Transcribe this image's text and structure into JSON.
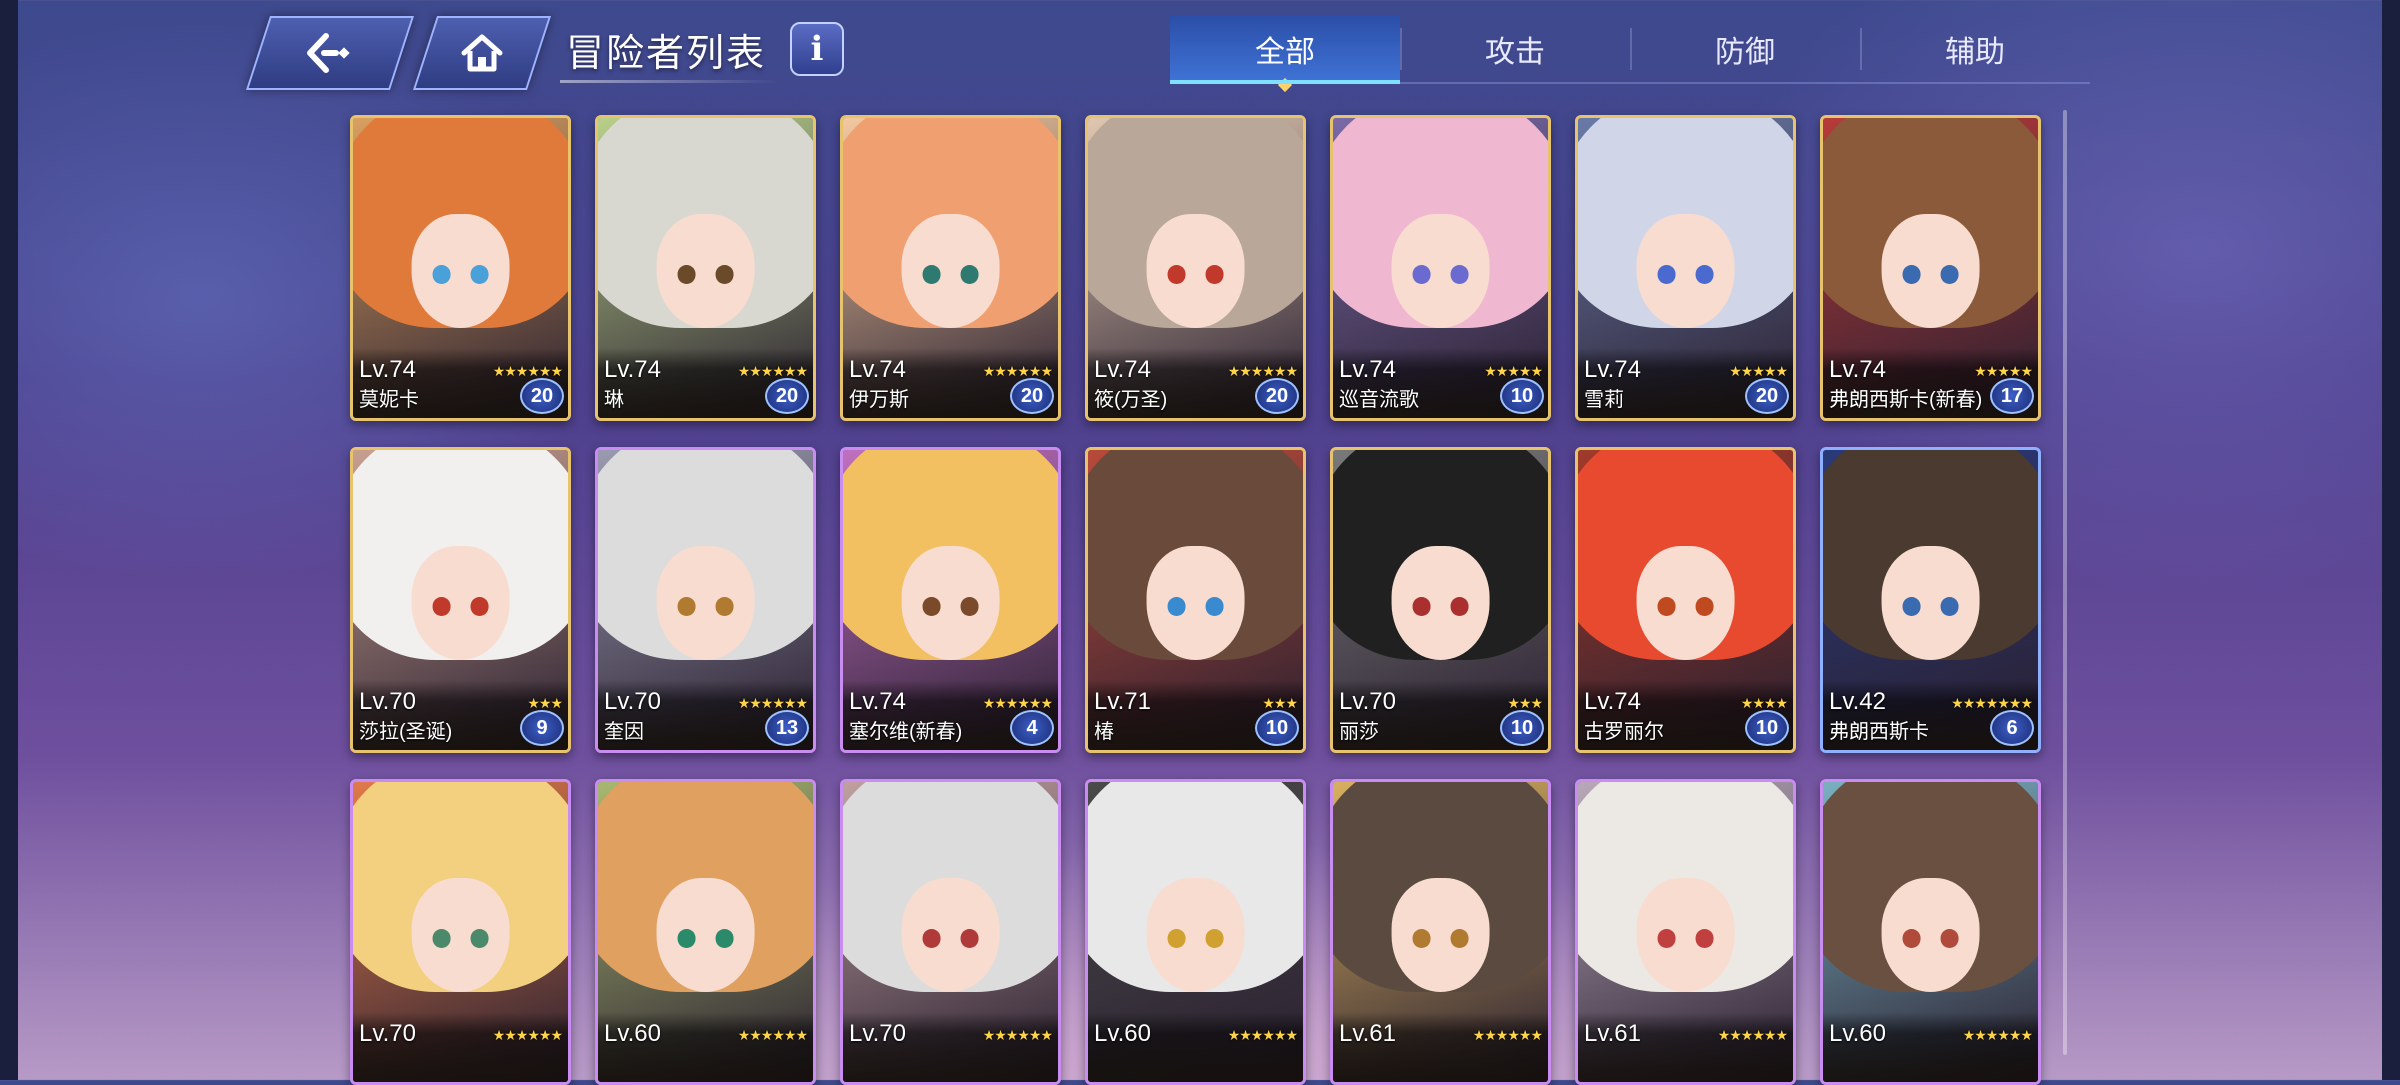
{
  "header": {
    "title": "冒险者列表",
    "info_label": "i",
    "tabs": [
      {
        "label": "全部",
        "active": true
      },
      {
        "label": "攻击",
        "active": false
      },
      {
        "label": "防御",
        "active": false
      },
      {
        "label": "辅助",
        "active": false
      }
    ]
  },
  "cards": [
    {
      "level": "Lv.74",
      "stars": "★★★★★★",
      "name": "莫妮卡",
      "badge": "20",
      "frame": "gold",
      "hair": "#e07a3a",
      "bg": "#d9a060",
      "eye": "#4aa0d8"
    },
    {
      "level": "Lv.74",
      "stars": "★★★★★★",
      "name": "琳",
      "badge": "20",
      "frame": "gold",
      "hair": "#d8d8d0",
      "bg": "#b8d08a",
      "eye": "#6b4a2a"
    },
    {
      "level": "Lv.74",
      "stars": "★★★★★★",
      "name": "伊万斯",
      "badge": "20",
      "frame": "gold",
      "hair": "#f0a070",
      "bg": "#f3c9a0",
      "eye": "#2f7a70"
    },
    {
      "level": "Lv.74",
      "stars": "★★★★★★",
      "name": "筱(万圣)",
      "badge": "20",
      "frame": "gold",
      "hair": "#b9a79a",
      "bg": "#e0c7b0",
      "eye": "#c0392b"
    },
    {
      "level": "Lv.74",
      "stars": "★★★★★",
      "name": "巡音流歌",
      "badge": "10",
      "frame": "gold",
      "hair": "#f0b8d0",
      "bg": "#7a6aa8",
      "eye": "#6a6ad0"
    },
    {
      "level": "Lv.74",
      "stars": "★★★★★",
      "name": "雪莉",
      "badge": "20",
      "frame": "gold",
      "hair": "#d0d6e8",
      "bg": "#6a7aa8",
      "eye": "#4a6ad0"
    },
    {
      "level": "Lv.74",
      "stars": "★★★★★",
      "name": "弗朗西斯卡(新春)",
      "badge": "17",
      "frame": "gold",
      "hair": "#8a5a3a",
      "bg": "#b83a3a",
      "eye": "#3a6ab0"
    },
    {
      "level": "Lv.70",
      "stars": "★★★",
      "name": "莎拉(圣诞)",
      "badge": "9",
      "frame": "gold",
      "hair": "#f2f0ee",
      "bg": "#c8a090",
      "eye": "#c0392b"
    },
    {
      "level": "Lv.70",
      "stars": "★★★★★★",
      "name": "奎因",
      "badge": "13",
      "frame": "purple",
      "hair": "#dcdcdc",
      "bg": "#9a9ab0",
      "eye": "#b07a30"
    },
    {
      "level": "Lv.74",
      "stars": "★★★★★★",
      "name": "塞尔维(新春)",
      "badge": "4",
      "frame": "purple",
      "hair": "#f2c060",
      "bg": "#c070c0",
      "eye": "#7a4a2a"
    },
    {
      "level": "Lv.71",
      "stars": "★★★",
      "name": "椿",
      "badge": "10",
      "frame": "gold",
      "hair": "#6a4a3a",
      "bg": "#b84a3a",
      "eye": "#3a8ad0"
    },
    {
      "level": "Lv.70",
      "stars": "★★★",
      "name": "丽莎",
      "badge": "10",
      "frame": "gold",
      "hair": "#202020",
      "bg": "#7a7a7a",
      "eye": "#aa3030"
    },
    {
      "level": "Lv.74",
      "stars": "★★★★",
      "name": "古罗丽尔",
      "badge": "10",
      "frame": "gold",
      "hair": "#e84a30",
      "bg": "#a03a2a",
      "eye": "#c04a20"
    },
    {
      "level": "Lv.42",
      "stars": "★★★★★★★",
      "name": "弗朗西斯卡",
      "badge": "6",
      "frame": "blue",
      "hair": "#4a3a30",
      "bg": "#2a3a7a",
      "eye": "#3a6ab0"
    },
    {
      "level": "Lv.70",
      "stars": "★★★★★★",
      "name": "",
      "badge": "",
      "frame": "purple",
      "hair": "#f2d080",
      "bg": "#e07a4a",
      "eye": "#4a8a6a"
    },
    {
      "level": "Lv.60",
      "stars": "★★★★★★",
      "name": "",
      "badge": "",
      "frame": "purple",
      "hair": "#e0a060",
      "bg": "#a8b870",
      "eye": "#2a8a6a"
    },
    {
      "level": "Lv.70",
      "stars": "★★★★★★",
      "name": "",
      "badge": "",
      "frame": "purple",
      "hair": "#dcdcdc",
      "bg": "#c0a0a0",
      "eye": "#b03a3a"
    },
    {
      "level": "Lv.60",
      "stars": "★★★★★★",
      "name": "",
      "badge": "",
      "frame": "purple",
      "hair": "#e8e8e8",
      "bg": "#4a4a4a",
      "eye": "#d0a030"
    },
    {
      "level": "Lv.61",
      "stars": "★★★★★★",
      "name": "",
      "badge": "",
      "frame": "purple",
      "hair": "#5a4a40",
      "bg": "#d8b060",
      "eye": "#b07a30"
    },
    {
      "level": "Lv.61",
      "stars": "★★★★★★",
      "name": "",
      "badge": "",
      "frame": "purple",
      "hair": "#ece8e4",
      "bg": "#b8a8b8",
      "eye": "#c04040"
    },
    {
      "level": "Lv.60",
      "stars": "★★★★★★",
      "name": "",
      "badge": "",
      "frame": "purple",
      "hair": "#6a5040",
      "bg": "#7ab0c0",
      "eye": "#b04a3a"
    }
  ]
}
